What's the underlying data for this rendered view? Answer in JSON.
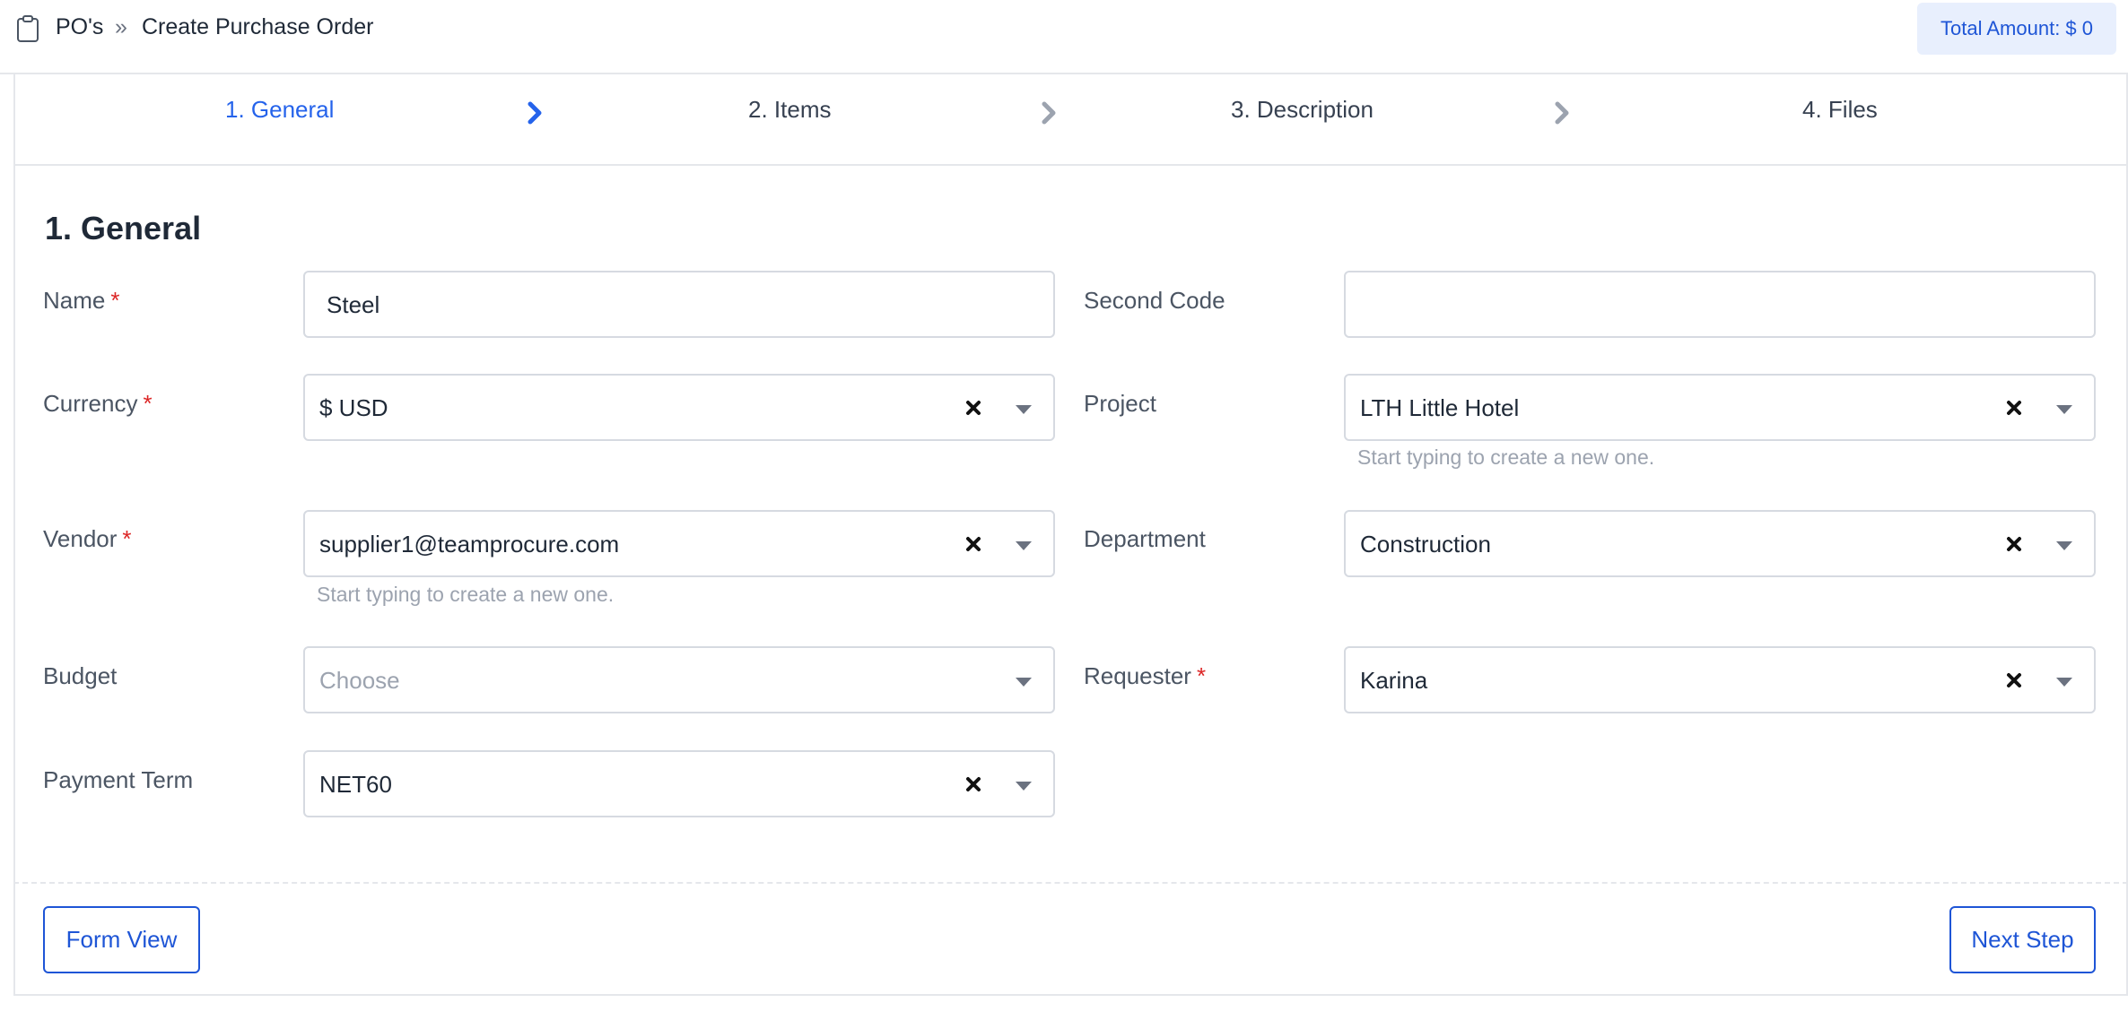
{
  "header": {
    "breadcrumb_root": "PO's",
    "breadcrumb_sep": "»",
    "breadcrumb_current": "Create Purchase Order",
    "total_amount": "Total Amount: $ 0"
  },
  "stepper": {
    "steps": [
      {
        "label": "1. General",
        "active": true
      },
      {
        "label": "2. Items",
        "active": false
      },
      {
        "label": "3. Description",
        "active": false
      },
      {
        "label": "4. Files",
        "active": false
      }
    ]
  },
  "form": {
    "title": "1. General",
    "name": {
      "label": "Name",
      "required": "*",
      "value": "Steel"
    },
    "second_code": {
      "label": "Second Code",
      "value": ""
    },
    "currency": {
      "label": "Currency",
      "required": "*",
      "value": "$ USD"
    },
    "project": {
      "label": "Project",
      "value": "LTH Little Hotel",
      "hint": "Start typing to create a new one."
    },
    "vendor": {
      "label": "Vendor",
      "required": "*",
      "value": "supplier1@teamprocure.com",
      "hint": "Start typing to create a new one."
    },
    "department": {
      "label": "Department",
      "value": "Construction"
    },
    "budget": {
      "label": "Budget",
      "placeholder": "Choose"
    },
    "requester": {
      "label": "Requester",
      "required": "*",
      "value": "Karina"
    },
    "payment_term": {
      "label": "Payment Term",
      "value": "NET60"
    }
  },
  "footer": {
    "form_view_label": "Form View",
    "next_step_label": "Next Step"
  },
  "colors": {
    "accent": "#2563eb",
    "required": "#dc2626",
    "badge_bg": "#e8effd"
  },
  "icons": {
    "breadcrumb": "clipboard-icon",
    "step_separator": "chevron-right-icon",
    "clear": "close-icon",
    "dropdown": "caret-down-icon"
  }
}
